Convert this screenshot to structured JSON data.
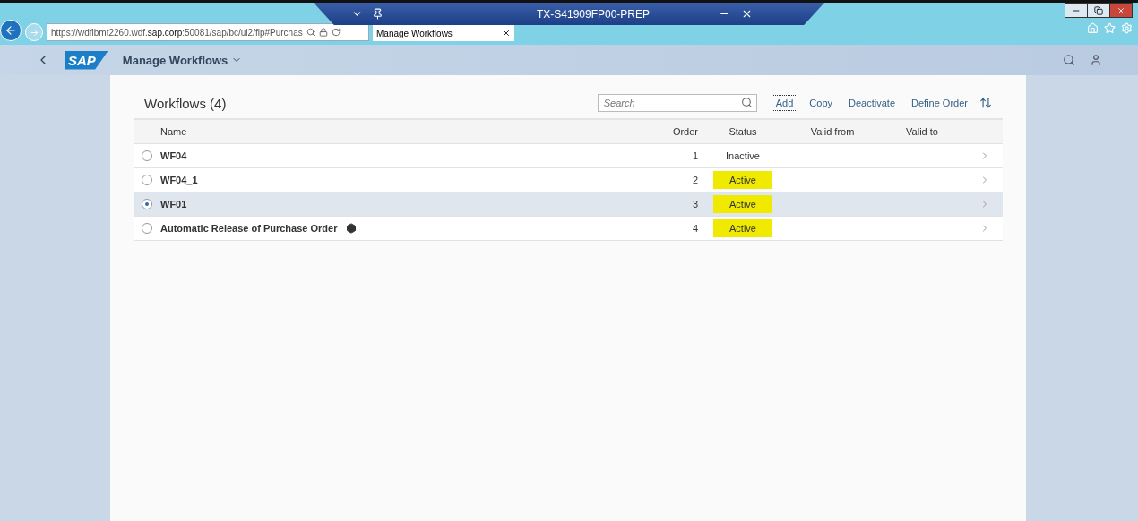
{
  "remote_bar": {
    "title": "TX-S41909FP00-PREP"
  },
  "browser": {
    "address": "https://wdflbmt2260.wdf.**sap.corp**:50081/sap/bc/ui2/flp#Purchas",
    "tabs": [
      {
        "label": "Manage Workflows",
        "selected": true
      }
    ]
  },
  "shell": {
    "logo": "SAP",
    "title": "Manage Workflows"
  },
  "table": {
    "title": "Workflows (4)",
    "search": {
      "placeholder": "Search"
    },
    "actions": [
      {
        "label": "Add",
        "focused": true
      },
      {
        "label": "Copy",
        "focused": false
      },
      {
        "label": "Deactivate",
        "focused": false
      },
      {
        "label": "Define Order",
        "focused": false
      }
    ],
    "columns": [
      "Name",
      "Order",
      "Status",
      "Valid from",
      "Valid to"
    ],
    "rows": [
      {
        "name": "WF04",
        "order": "1",
        "status": "Inactive",
        "selected": false,
        "highlighted": false,
        "has_icon": false
      },
      {
        "name": "WF04_1",
        "order": "2",
        "status": "Active",
        "selected": false,
        "highlighted": true,
        "has_icon": false
      },
      {
        "name": "WF01",
        "order": "3",
        "status": "Active",
        "selected": true,
        "highlighted": true,
        "has_icon": false
      },
      {
        "name": "Automatic Release of Purchase Order",
        "order": "4",
        "status": "Active",
        "selected": false,
        "highlighted": true,
        "has_icon": true
      }
    ]
  }
}
